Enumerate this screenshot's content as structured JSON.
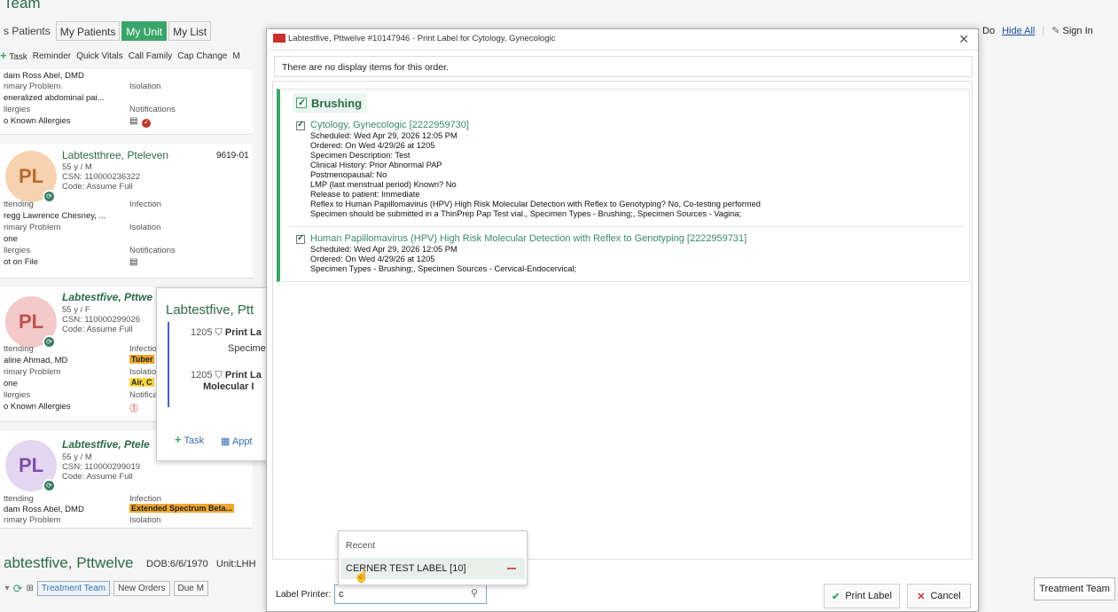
{
  "background": {
    "title": "Team",
    "tabs": [
      "s Patients",
      "My Patients",
      "My Unit",
      "My List"
    ],
    "toolbar": [
      "Task",
      "Reminder",
      "Quick Vitals",
      "Call Family",
      "Cap Change",
      "M"
    ],
    "right_links": {
      "do": "Do",
      "hide_all": "Hide All",
      "sign_in": "Sign In"
    },
    "treatment_team_button": "Treatment Team",
    "patients": [
      {
        "attending": "dam Ross Abel, DMD",
        "primary_problem_label": "rimary Problem",
        "primary_problem": "eneralized abdominal pai...",
        "allergies_label": "llergies",
        "allergies": "o Known Allergies",
        "isolation_label": "Isolation",
        "notifications_label": "Notifications"
      },
      {
        "initials": "PL",
        "name": "Labtestthree, Pteleven",
        "room": "9619-01",
        "age_sex": "55 y / M",
        "csn": "CSN: 110000236322",
        "code": "Code: Assume Full",
        "attending_label": "ttending",
        "attending": "regg Lawrence Chesney, ...",
        "primary_problem_label": "rimary Problem",
        "primary_problem": "one",
        "allergies_label": "llergies",
        "allergies": "ot on File",
        "infection_label": "Infection",
        "isolation_label": "Isolation",
        "notifications_label": "Notifications"
      },
      {
        "initials": "PL",
        "name": "Labtestfive, Pttwe",
        "age_sex": "55 y / F",
        "csn": "CSN: 110000299026",
        "code": "Code: Assume Full",
        "attending_label": "ttending",
        "attending": "aline Ahmad, MD",
        "primary_problem_label": "rimary Problem",
        "primary_problem": "one",
        "allergies_label": "llergies",
        "allergies": "o Known Allergies",
        "infection_label": "Infectio",
        "infection_tag": "Tuber",
        "isolation_label": "Isolatio",
        "isolation_tag": "Air, C",
        "notifications_label": "Notifica"
      },
      {
        "initials": "PL",
        "name": "Labtestfive, Ptele",
        "age_sex": "55 y / M",
        "csn": "CSN: 110000299019",
        "code": "Code: Assume Full",
        "attending_label": "ttending",
        "attending": "dam Ross Abel, DMD",
        "primary_problem_label": "rimary Problem",
        "infection_label": "Infection",
        "infection_tag": "Extended Spectrum Beta...",
        "isolation_label": "Isolation"
      }
    ],
    "popover": {
      "title": "Labtestfive, Ptt",
      "row1_time": "1205",
      "row1_text": "Print La",
      "row1_sub": "Specimen s",
      "row2_time": "1205",
      "row2_text": "Print La",
      "row2_sub": "Molecular I",
      "task": "Task",
      "appt": "Appt"
    },
    "bottom": {
      "name": "abtestfive, Pttwelve",
      "dob": "DOB:6/6/1970",
      "unit": "Unit:LHH",
      "buttons": [
        "Treatment Team",
        "New Orders",
        "Due M"
      ]
    }
  },
  "modal": {
    "title": "Labtestfive, Pttwelve #10147946 - Print Label for Cytology, Gynecologic",
    "note": "There are no display items for this order.",
    "group": "Brushing",
    "orders": [
      {
        "title": "Cytology, Gynecologic [2222959730]",
        "details": [
          "Scheduled: Wed Apr 29, 2026 12:05 PM",
          "Ordered: On Wed 4/29/26 at 1205",
          "Specimen Description: Test",
          "Clinical History: Prior Abnormal PAP",
          "Postmenopausal: No",
          "LMP (last menstrual period) Known? No",
          "Release to patient: Immediate",
          "Reflex to Human Papillomavirus (HPV) High Risk Molecular Detection with Reflex to Genotyping? No, Co-testing performed",
          "Specimen should be submitted in a ThinPrep Pap Test vial., Specimen Types - Brushing;, Specimen Sources - Vagina;"
        ]
      },
      {
        "title": "Human Papillomavirus (HPV) High Risk Molecular Detection with Reflex to Genotyping [2222959731]",
        "details": [
          "Scheduled: Wed Apr 29, 2026 12:05 PM",
          "Ordered: On Wed 4/29/26 at 1205",
          "Specimen Types - Brushing;, Specimen Sources - Cervical-Endocervical;"
        ]
      }
    ],
    "label_printer_label": "Label Printer:",
    "label_printer_value": "c",
    "dropdown": {
      "header": "Recent",
      "item": "CERNER TEST LABEL [10]"
    },
    "print_button": "Print Label",
    "cancel_button": "Cancel"
  },
  "colors": {
    "accent": "#3aa56a",
    "brand_red": "#c9302c",
    "link": "#1a4fa0"
  }
}
